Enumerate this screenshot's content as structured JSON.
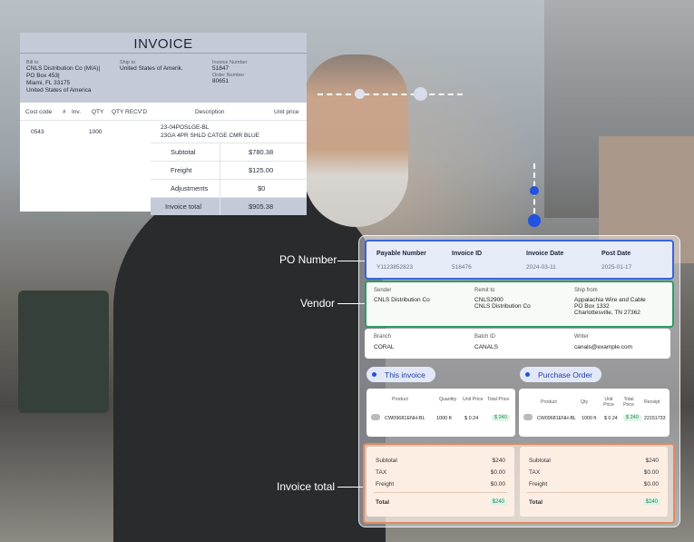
{
  "invoice": {
    "title": "INVOICE",
    "bill_to_label": "Bill to",
    "bill_to_lines": [
      "CNLS Distribution Co (MIA)|",
      "PO Box 453|",
      "Miami, FL 33175",
      "United States of America"
    ],
    "ship_to_label": "Ship to",
    "ship_to_value": "United States of Amerik.",
    "invoice_number_label": "Invoice Number",
    "invoice_number": "51847",
    "order_number_label": "Order Number",
    "order_number": "80651",
    "columns": [
      "Cost code",
      "#",
      "Inv.",
      "QTY",
      "QTY RECV'D",
      "Description",
      "Unit price"
    ],
    "row": {
      "cost_code": "0543",
      "qty": "1000",
      "description_1": "23-04POSLGE-BL",
      "description_2": "23GA 4PR SHLD CATGE CMR BLUE"
    },
    "totals": [
      {
        "label": "Subtotal",
        "value": "$780.38"
      },
      {
        "label": "Freight",
        "value": "$125.00"
      },
      {
        "label": "Adjustments",
        "value": "$0"
      },
      {
        "label": "Invoice total",
        "value": "$905.38"
      }
    ]
  },
  "callouts": {
    "po_number": "PO Number",
    "vendor": "Vendor",
    "invoice_total": "Invoice total"
  },
  "po_card": {
    "headers": [
      "Payable Number",
      "Invoice ID",
      "Invoice Date",
      "Post Date"
    ],
    "values": [
      "Y1123852823",
      "518476",
      "2024-03-11",
      "2025-01-17"
    ]
  },
  "vendor_card": {
    "sender_label": "Sender",
    "sender": "CNLS Distribution Co",
    "remit_label": "Remit to",
    "remit_1": "CNLS2900",
    "remit_2": "CNLS Distribution Co",
    "ship_from_label": "Ship from",
    "ship_from_1": "Appalachia Wire and Cable",
    "ship_from_2": "PO Box 1332",
    "ship_from_3": "Charlottesville, TN 27362"
  },
  "branch_card": {
    "branch_label": "Branch",
    "branch": "CORAL",
    "batch_label": "Batch ID",
    "batch": "CANALS",
    "writer_label": "Writer",
    "writer": "canals@example.com"
  },
  "this_invoice": {
    "pill": "This invoice",
    "headers": [
      "Product",
      "Quantity",
      "Unit Price",
      "Total Price"
    ],
    "product": "CW09681ENH-BL",
    "quantity": "1000 ft",
    "unit_price": "$ 0.24",
    "total": "$ 240"
  },
  "purchase_order": {
    "pill": "Purchase Order",
    "headers": [
      "Product",
      "Qty",
      "Unit Price",
      "Total Price",
      "Receipt"
    ],
    "product": "CW09681ENH-BL",
    "qty": "1000 ft",
    "unit_price": "$ 0.24",
    "total": "$ 240",
    "receipt": "22151733"
  },
  "summary_left": [
    {
      "label": "Subtotal",
      "value": "$240"
    },
    {
      "label": "TAX",
      "value": "$0.00"
    },
    {
      "label": "Freight",
      "value": "$0.00"
    }
  ],
  "summary_left_total": {
    "label": "Total",
    "value": "$240"
  },
  "summary_right": [
    {
      "label": "Subtotal",
      "value": "$240"
    },
    {
      "label": "TAX",
      "value": "$0.00"
    },
    {
      "label": "Freight",
      "value": "$0.00"
    }
  ],
  "summary_right_total": {
    "label": "Total",
    "value": "$240"
  },
  "colors": {
    "po_border": "#3a63d8",
    "vendor_border": "#2e9b63",
    "total_border": "#e08a5c",
    "pill_text": "#1e3da8"
  }
}
